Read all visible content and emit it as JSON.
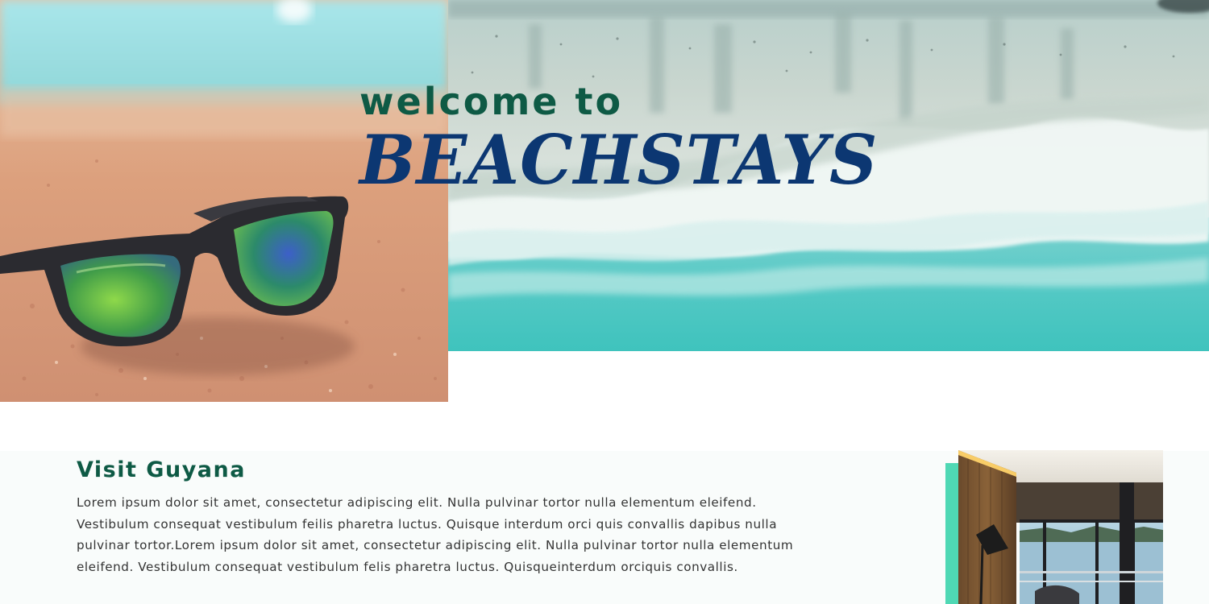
{
  "hero": {
    "welcome": "welcome to",
    "brand": "BEACHSTAYS"
  },
  "intro": {
    "title": "Visit Guyana",
    "body": "Lorem ipsum dolor sit amet, consectetur adipiscing elit. Nulla pulvinar tortor nulla elementum eleifend. Vestibulum consequat vestibulum feilis pharetra luctus. Quisque interdum orci quis convallis dapibus nulla pulvinar tortor.Lorem ipsum dolor sit amet, consectetur adipiscing elit. Nulla pulvinar tortor nulla elementum eleifend. Vestibulum consequat vestibulum felis pharetra luctus. Quisqueinterdum orciquis convallis."
  },
  "colors": {
    "heading_green": "#0e5a45",
    "brand_navy": "#0c3772",
    "accent_teal": "#4fd8b4"
  },
  "images": {
    "hero_left": "sunglasses-on-sand-photo",
    "hero_right": "aerial-beach-waves-photo",
    "room": "lakeside-room-interior-photo"
  }
}
